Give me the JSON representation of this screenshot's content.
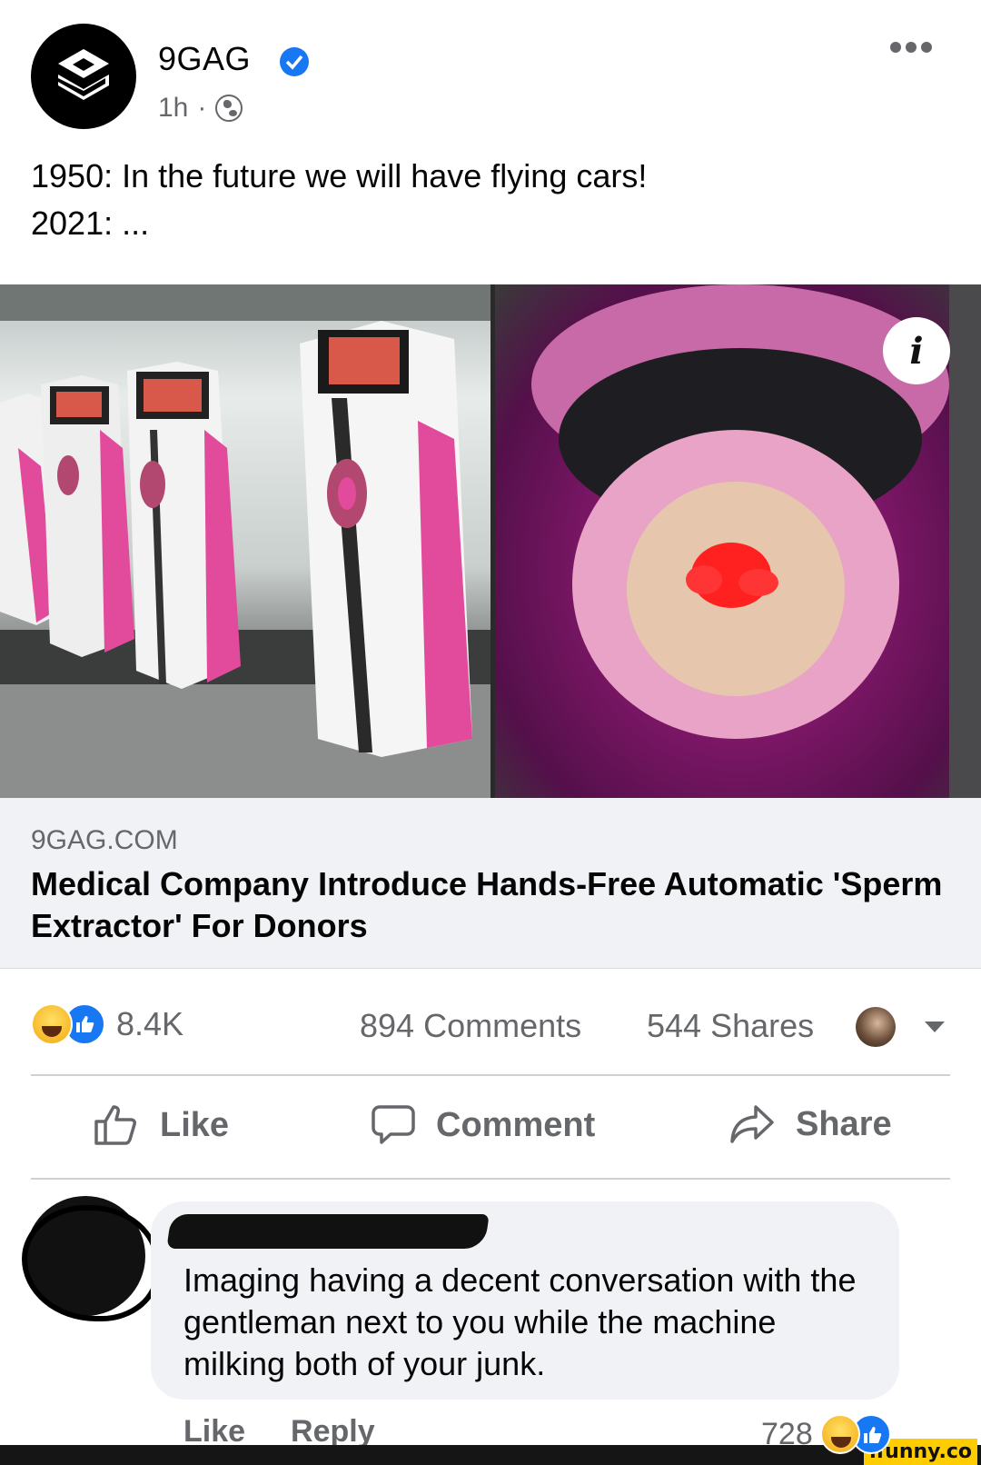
{
  "post": {
    "page_name": "9GAG",
    "time": "1h",
    "separator": "·",
    "text_line1": "1950: In the future we will have flying cars!",
    "text_line2": "2021: ..."
  },
  "link": {
    "domain": "9GAG.COM",
    "title": "Medical Company Introduce Hands-Free Automatic 'Sperm Extractor' For Donors"
  },
  "stats": {
    "reactions": "8.4K",
    "comments": "894 Comments",
    "shares": "544 Shares"
  },
  "actions": {
    "like": "Like",
    "comment": "Comment",
    "share": "Share"
  },
  "comment": {
    "text": "Imaging having a decent conversation with the gentleman next to you while the machine milking both of your junk.",
    "like": "Like",
    "reply": "Reply",
    "reaction_count": "728"
  },
  "icons": {
    "info": "i",
    "watermark": "ifunny.co"
  },
  "colors": {
    "accent": "#1877f2",
    "secondary_text": "#65676b",
    "link_box_bg": "#f0f2f5",
    "machine_pink": "#e24a9b"
  }
}
